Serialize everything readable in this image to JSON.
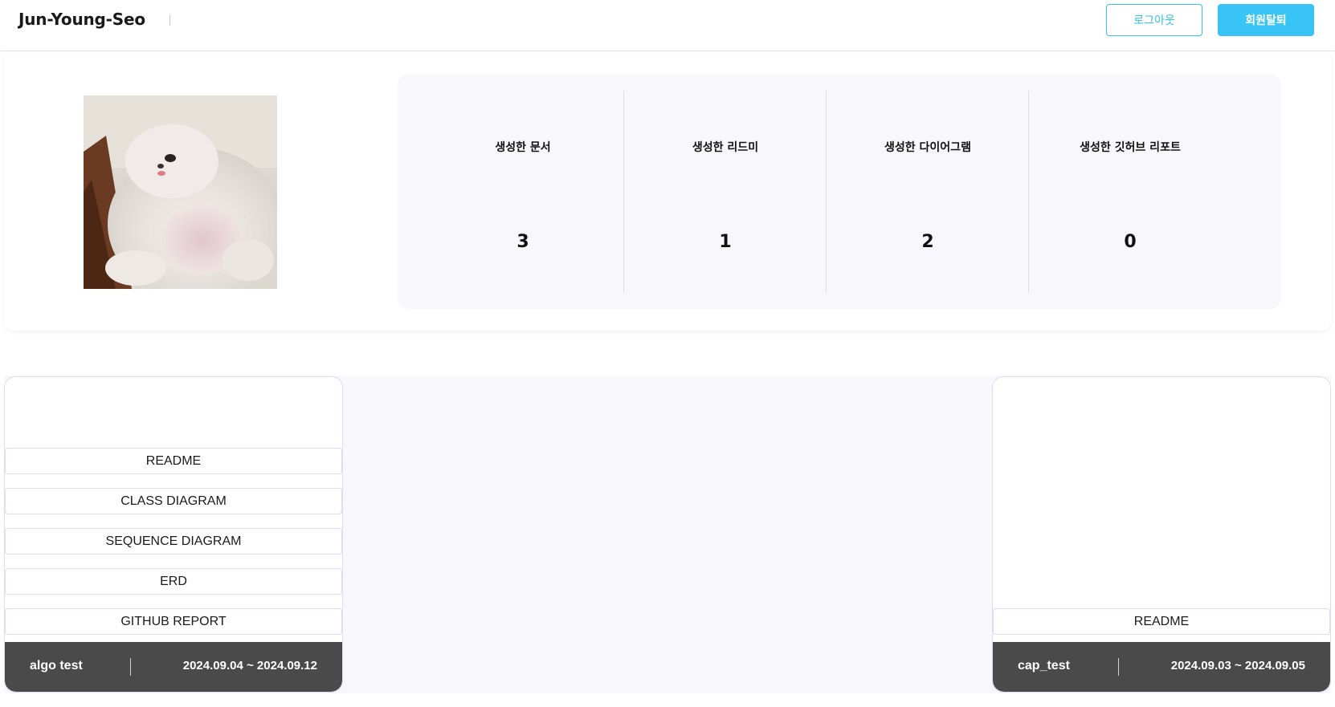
{
  "header": {
    "username": "Jun-Young-Seo",
    "logout_label": "로그아웃",
    "withdraw_label": "회원탈퇴"
  },
  "colors": {
    "accent": "#38c4f4",
    "footer": "#4a4a4a",
    "panel": "#f8f8fc"
  },
  "stats": [
    {
      "label": "생성한 문서",
      "value": "3"
    },
    {
      "label": "생성한 리드미",
      "value": "1"
    },
    {
      "label": "생성한 다이어그램",
      "value": "2"
    },
    {
      "label": "생성한 깃허브 리포트",
      "value": "0"
    }
  ],
  "projects": [
    {
      "name": "algo test",
      "dates": "2024.09.04 ~ 2024.09.12",
      "buttons": [
        "README",
        "CLASS DIAGRAM",
        "SEQUENCE DIAGRAM",
        "ERD",
        "GITHUB REPORT"
      ]
    },
    {
      "name": "cap_test",
      "dates": "2024.09.03 ~ 2024.09.05",
      "buttons": [
        "README"
      ]
    }
  ]
}
